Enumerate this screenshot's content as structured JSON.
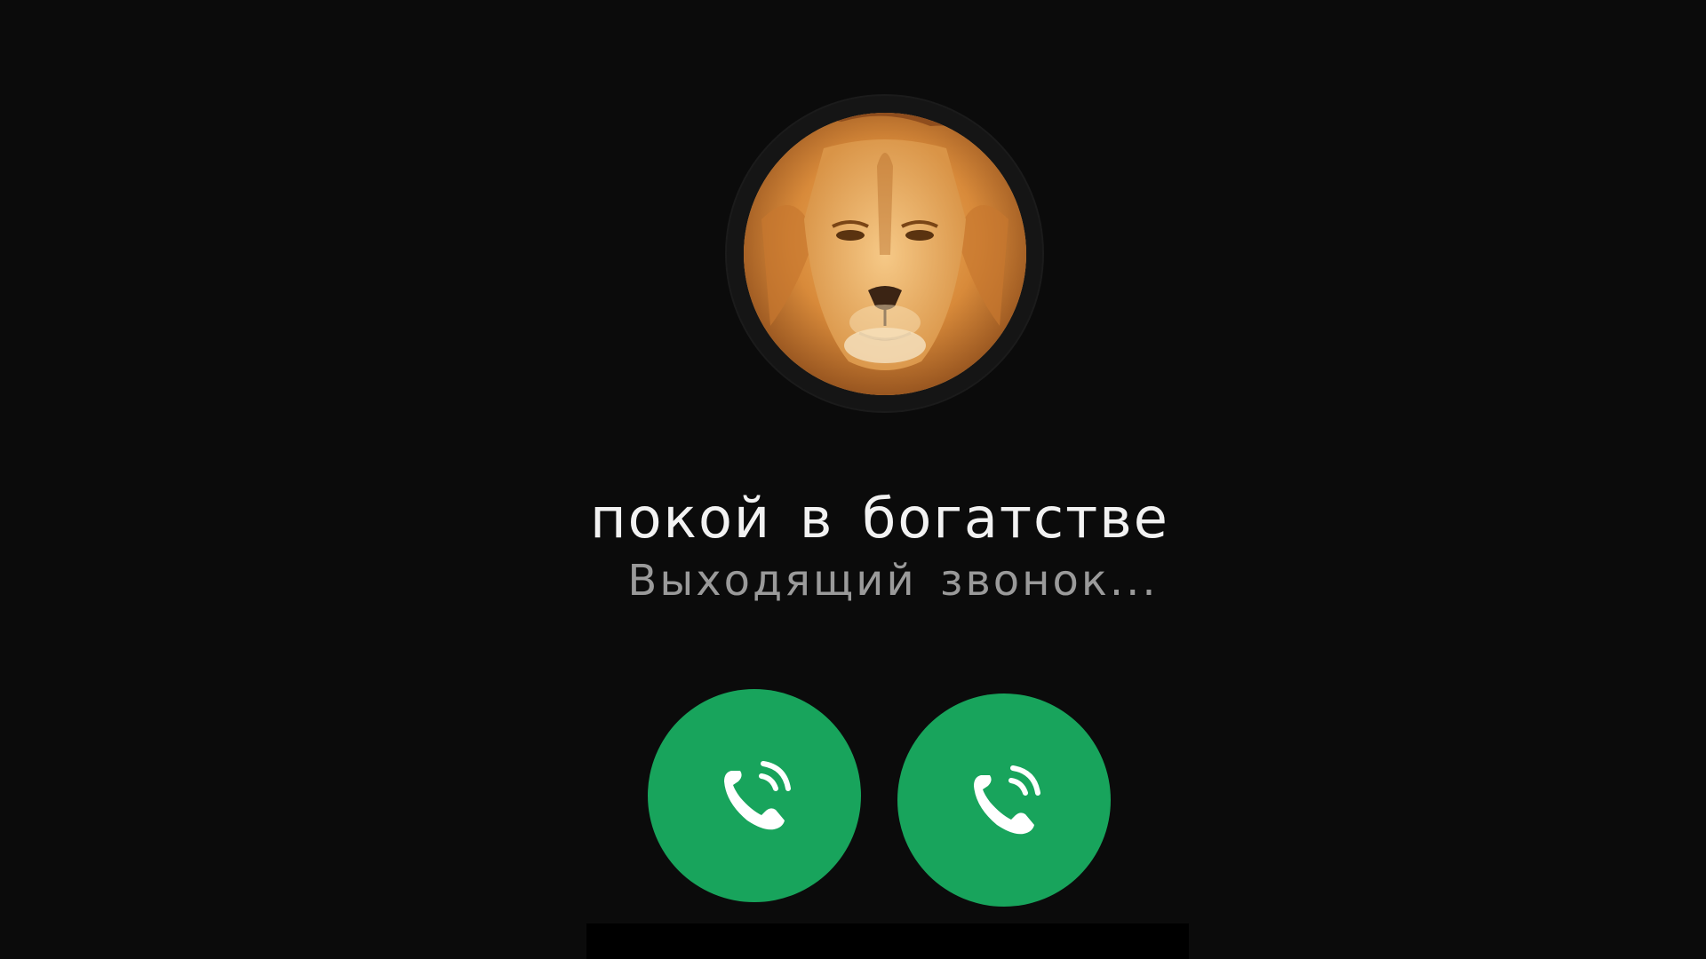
{
  "contact": {
    "name": "покой в богатстве",
    "avatar_icon": "lion-photo"
  },
  "call": {
    "status": "Выходящий звонок..."
  },
  "buttons": [
    {
      "icon": "phone-call-icon",
      "color": "#18a45c"
    },
    {
      "icon": "phone-call-icon",
      "color": "#18a45c"
    }
  ],
  "colors": {
    "background": "#0b0b0b",
    "accent": "#18a45c",
    "name_text": "#f2f2f2",
    "status_text": "#9a9a9a"
  }
}
